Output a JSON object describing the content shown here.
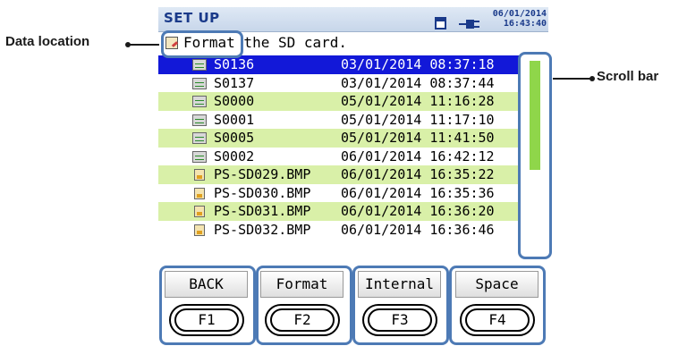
{
  "header": {
    "title": "SET UP",
    "date": "06/01/2014",
    "time": "16:43:40",
    "icons": [
      "sd-card-icon",
      "power-plug-icon"
    ]
  },
  "location": {
    "icon": "sd-format-icon",
    "text": "Format the SD card."
  },
  "files": [
    {
      "name": "S0136",
      "date": "03/01/2014 08:37:18",
      "type": "signal",
      "selected": true
    },
    {
      "name": "S0137",
      "date": "03/01/2014 08:37:44",
      "type": "signal",
      "selected": false
    },
    {
      "name": "S0000",
      "date": "05/01/2014 11:16:28",
      "type": "signal",
      "selected": false
    },
    {
      "name": "S0001",
      "date": "05/01/2014 11:17:10",
      "type": "signal",
      "selected": false
    },
    {
      "name": "S0005",
      "date": "05/01/2014 11:41:50",
      "type": "signal",
      "selected": false
    },
    {
      "name": "S0002",
      "date": "06/01/2014 16:42:12",
      "type": "signal",
      "selected": false
    },
    {
      "name": "PS-SD029.BMP",
      "date": "06/01/2014 16:35:22",
      "type": "image",
      "selected": false
    },
    {
      "name": "PS-SD030.BMP",
      "date": "06/01/2014 16:35:36",
      "type": "image",
      "selected": false
    },
    {
      "name": "PS-SD031.BMP",
      "date": "06/01/2014 16:36:20",
      "type": "image",
      "selected": false
    },
    {
      "name": "PS-SD032.BMP",
      "date": "06/01/2014 16:36:46",
      "type": "image",
      "selected": false
    }
  ],
  "soft_keys": [
    {
      "label": "BACK",
      "key": "F1"
    },
    {
      "label": "Format",
      "key": "F2"
    },
    {
      "label": "Internal",
      "key": "F3"
    },
    {
      "label": "Space",
      "key": "F4"
    }
  ],
  "annotations": {
    "data_location": "Data location",
    "scroll_bar": "Scroll bar"
  },
  "colors": {
    "selected_row": "#1218d8",
    "alt_row": "#d9f0a8",
    "scroll_thumb": "#8fd64a",
    "callout_border": "#4d7ab5",
    "title_text": "#1a3a8a"
  }
}
